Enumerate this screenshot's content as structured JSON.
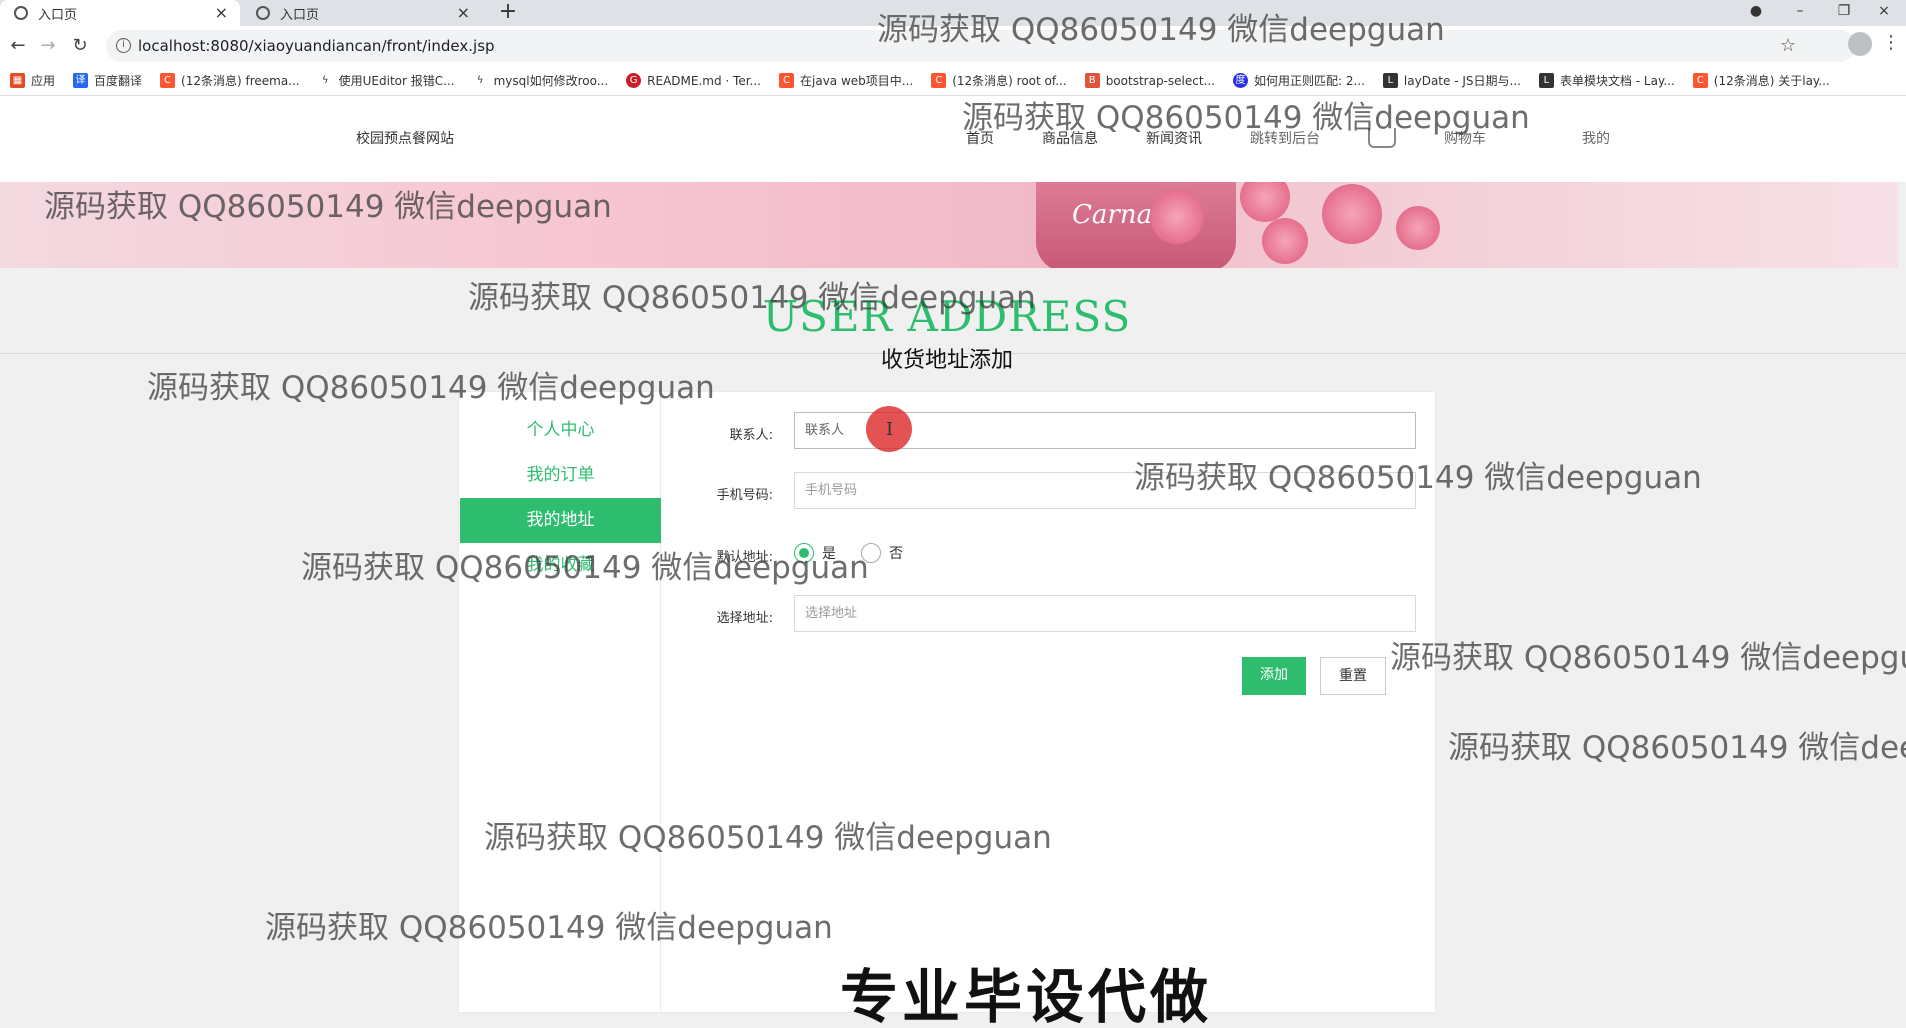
{
  "browser": {
    "tabs": [
      {
        "title": "入口页",
        "active": true
      },
      {
        "title": "入口页",
        "active": false
      }
    ],
    "url": "localhost:8080/xiaoyuandiancan/front/index.jsp",
    "bookmarks": [
      {
        "label": "应用",
        "icon": "apps-icon",
        "color": "#e44d26"
      },
      {
        "label": "百度翻译",
        "icon": "baidu-translate-icon",
        "color": "#2468f2"
      },
      {
        "label": "(12条消息) freema...",
        "icon": "csdn-icon",
        "color": "#fc5531"
      },
      {
        "label": "使用UEditor 报错C...",
        "icon": "ueditor-icon",
        "color": "#333333"
      },
      {
        "label": "mysql如何修改roo...",
        "icon": "mysql-icon",
        "color": "#333333"
      },
      {
        "label": "README.md · Ter...",
        "icon": "gitee-icon",
        "color": "#c71d23"
      },
      {
        "label": "在java web项目中...",
        "icon": "csdn-icon",
        "color": "#fc5531"
      },
      {
        "label": "(12条消息) root of...",
        "icon": "csdn-icon",
        "color": "#fc5531"
      },
      {
        "label": "bootstrap-select...",
        "icon": "bootstrap-icon",
        "color": "#e0543b"
      },
      {
        "label": "如何用正则匹配: 2...",
        "icon": "baidu-icon",
        "color": "#2932e1"
      },
      {
        "label": "layDate - JS日期与...",
        "icon": "layui-icon",
        "color": "#333333"
      },
      {
        "label": "表单模块文档 - Lay...",
        "icon": "layui-icon",
        "color": "#333333"
      },
      {
        "label": "(12条消息) 关于lay...",
        "icon": "csdn-icon",
        "color": "#fc5531"
      }
    ]
  },
  "site": {
    "title": "校园预点餐网站",
    "nav": [
      "首页",
      "商品信息",
      "新闻资讯",
      "跳转到后台",
      "购物车",
      "我的"
    ],
    "banner_product_text": "Carnati"
  },
  "hero": {
    "title_en": "USER ADDRESS",
    "title_cn": "收货地址添加"
  },
  "sidebar": {
    "items": [
      {
        "label": "个人中心",
        "active": false
      },
      {
        "label": "我的订单",
        "active": false
      },
      {
        "label": "我的地址",
        "active": true
      },
      {
        "label": "我的收藏",
        "active": false
      }
    ]
  },
  "form": {
    "contact_label": "联系人:",
    "contact_placeholder": "联系人",
    "phone_label": "手机号码:",
    "phone_placeholder": "手机号码",
    "default_label": "默认地址:",
    "default_yes": "是",
    "default_no": "否",
    "default_selected": "是",
    "address_label": "选择地址:",
    "address_placeholder": "选择地址",
    "add_button": "添加",
    "reset_button": "重置"
  },
  "watermark": {
    "text": "源码获取 QQ86050149 微信deepguan",
    "promo": "专业毕设代做"
  },
  "colors": {
    "accent": "#2ebd6f",
    "cursor_highlight": "#dc2828"
  }
}
